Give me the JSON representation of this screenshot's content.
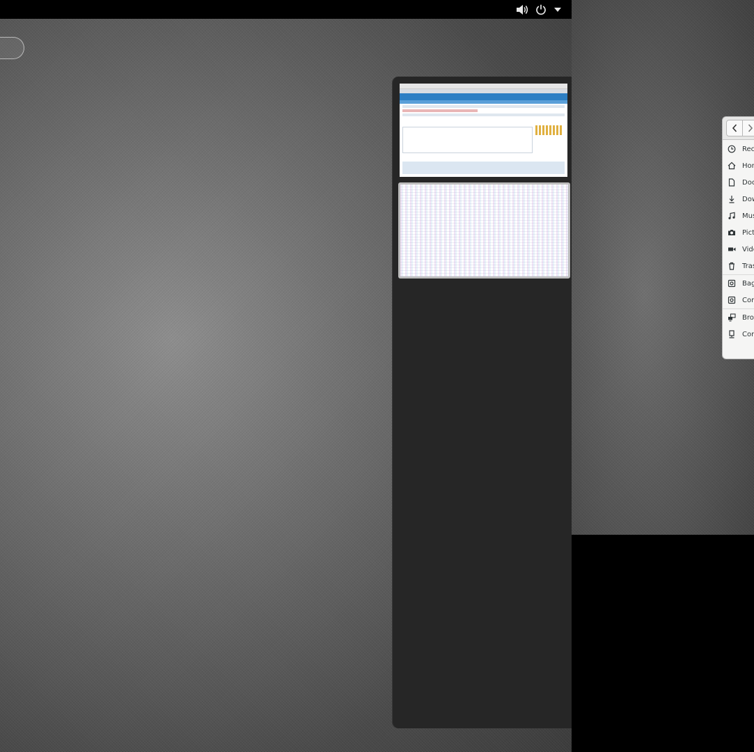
{
  "top_bar": {
    "volume_icon": "volume-high-icon",
    "power_icon": "power-icon",
    "menu_icon": "dropdown-arrow-icon"
  },
  "workspace_switcher": {
    "workspaces": [
      {
        "name": "workspace-1",
        "content": "browser-window-thumbnail"
      },
      {
        "name": "workspace-2",
        "content": "noisy-window-thumbnail",
        "selected": true
      }
    ]
  },
  "files_window": {
    "back_icon": "chevron-left-icon",
    "forward_icon": "chevron-right-icon",
    "places": [
      {
        "label": "Rece",
        "icon": "clock-icon"
      },
      {
        "label": "Hon",
        "icon": "home-icon"
      },
      {
        "label": "Doc",
        "icon": "document-icon"
      },
      {
        "label": "Dow",
        "icon": "download-icon"
      },
      {
        "label": "Mus",
        "icon": "music-icon"
      },
      {
        "label": "Pict",
        "icon": "camera-icon"
      },
      {
        "label": "Vide",
        "icon": "video-icon"
      },
      {
        "label": "Tras",
        "icon": "trash-icon"
      },
      {
        "label": "Bag",
        "icon": "drive-icon"
      },
      {
        "label": "Com",
        "icon": "drive-icon"
      },
      {
        "label": "Brov",
        "icon": "network-icon"
      },
      {
        "label": "Con",
        "icon": "connect-server-icon"
      }
    ]
  }
}
